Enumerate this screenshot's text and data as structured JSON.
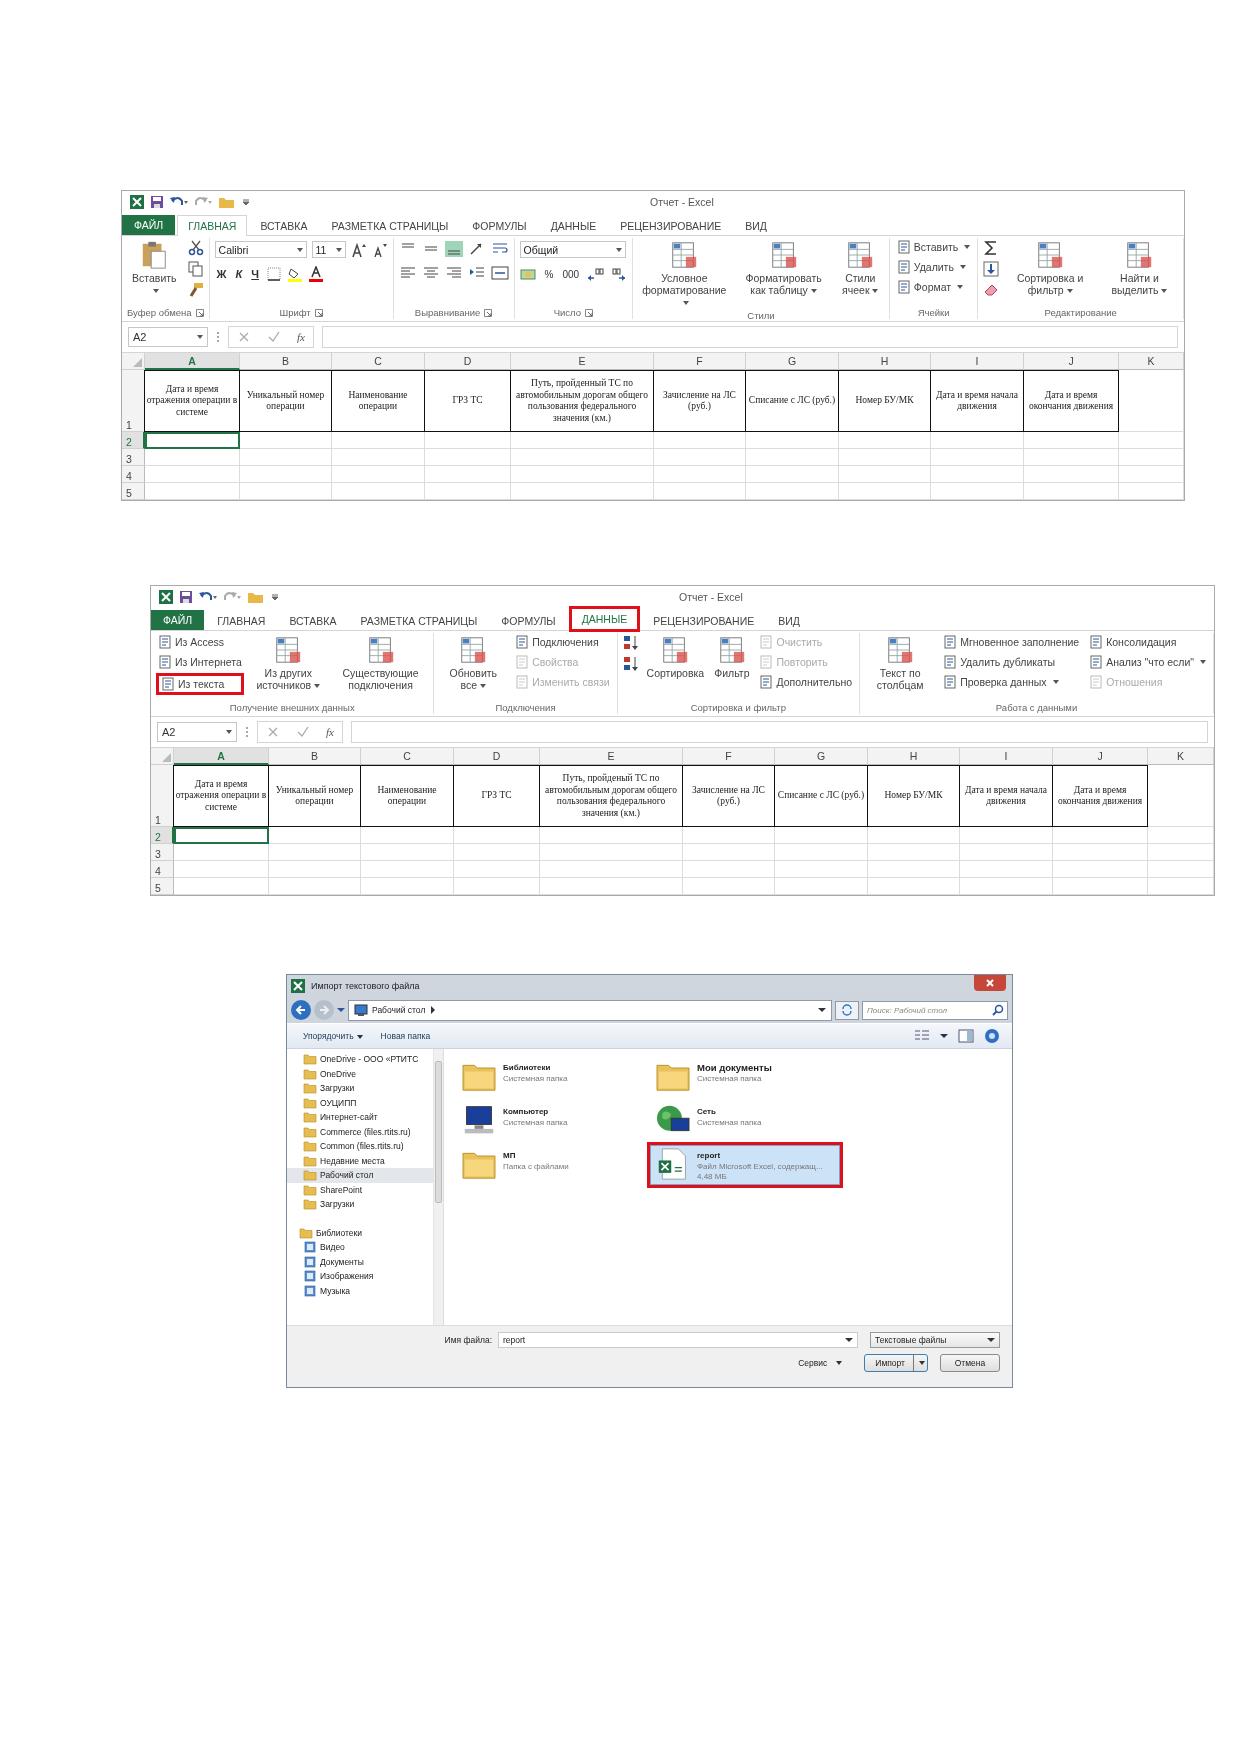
{
  "documents": [
    {
      "kind": "excel",
      "title": "Отчет - Excel",
      "file_tab": "ФАЙЛ",
      "tabs": [
        {
          "label": "ГЛАВНАЯ",
          "selected": true,
          "highlighted": false
        },
        {
          "label": "ВСТАВКА",
          "selected": false,
          "highlighted": false
        },
        {
          "label": "РАЗМЕТКА СТРАНИЦЫ",
          "selected": false,
          "highlighted": false
        },
        {
          "label": "ФОРМУЛЫ",
          "selected": false,
          "highlighted": false
        },
        {
          "label": "ДАННЫЕ",
          "selected": false,
          "highlighted": false
        },
        {
          "label": "РЕЦЕНЗИРОВАНИЕ",
          "selected": false,
          "highlighted": false
        },
        {
          "label": "ВИД",
          "selected": false,
          "highlighted": false
        }
      ],
      "ribbon": [
        {
          "kind": "clipboard",
          "label": "Буфер обмена",
          "launcher": true,
          "paste": "Вставить"
        },
        {
          "kind": "font",
          "label": "Шрифт",
          "launcher": true,
          "font": "Calibri",
          "size": "11",
          "styles": [
            "Ж",
            "К",
            "Ч"
          ]
        },
        {
          "kind": "alignment",
          "label": "Выравнивание",
          "launcher": true
        },
        {
          "kind": "number",
          "label": "Число",
          "launcher": true,
          "format": "Общий",
          "symbols": [
            "%",
            "000"
          ]
        },
        {
          "kind": "commands",
          "label": "Стили",
          "launcher": false,
          "items": [
            {
              "kind": "large",
              "label": "Условное форматирование",
              "menu": true,
              "disabled": false,
              "highlighted": false
            },
            {
              "kind": "large",
              "label": "Форматировать как таблицу",
              "menu": true,
              "disabled": false,
              "highlighted": false
            },
            {
              "kind": "large",
              "label": "Стили ячеек",
              "menu": true,
              "disabled": false,
              "highlighted": false
            }
          ]
        },
        {
          "kind": "commands",
          "label": "Ячейки",
          "launcher": false,
          "items": [
            {
              "kind": "stack",
              "items": [
                {
                  "label": "Вставить",
                  "menu": true,
                  "disabled": false,
                  "highlighted": false
                },
                {
                  "label": "Удалить",
                  "menu": true,
                  "disabled": false,
                  "highlighted": false
                },
                {
                  "label": "Формат",
                  "menu": true,
                  "disabled": false,
                  "highlighted": false
                }
              ]
            }
          ]
        },
        {
          "kind": "commands",
          "label": "Редактирование",
          "launcher": false,
          "items": [
            {
              "kind": "edit-tools"
            },
            {
              "kind": "large",
              "label": "Сортировка и фильтр",
              "menu": true,
              "disabled": false,
              "highlighted": false
            },
            {
              "kind": "large",
              "label": "Найти и выделить",
              "menu": true,
              "disabled": false,
              "highlighted": false
            }
          ]
        }
      ],
      "name_box": "A2",
      "function_label": "fx",
      "columns": [
        {
          "label": "A",
          "selected": true
        },
        {
          "label": "B",
          "selected": false
        },
        {
          "label": "C",
          "selected": false
        },
        {
          "label": "D",
          "selected": false
        },
        {
          "label": "E",
          "selected": false
        },
        {
          "label": "F",
          "selected": false
        },
        {
          "label": "G",
          "selected": false
        },
        {
          "label": "H",
          "selected": false
        },
        {
          "label": "I",
          "selected": false
        },
        {
          "label": "J",
          "selected": false
        },
        {
          "label": "K",
          "selected": false
        }
      ],
      "rows": [
        {
          "label": "1",
          "selected": false
        },
        {
          "label": "2",
          "selected": true
        },
        {
          "label": "3",
          "selected": false
        },
        {
          "label": "4",
          "selected": false
        },
        {
          "label": "5",
          "selected": false
        }
      ],
      "header_row": [
        "Дата и время отражения операции в системе",
        "Уникальный номер операции",
        "Наименование операции",
        "ГРЗ ТС",
        "Путь, пройденный ТС по автомобильным дорогам общего пользования федерального значения (км.)",
        "Зачисление на ЛС (руб.)",
        "Списание с ЛС (руб.)",
        "Номер БУ/МК",
        "Дата и время начала движения",
        "Дата и время окончания движения"
      ]
    },
    {
      "kind": "excel",
      "title": "Отчет - Excel",
      "file_tab": "ФАЙЛ",
      "tabs": [
        {
          "label": "ГЛАВНАЯ",
          "selected": false,
          "highlighted": false
        },
        {
          "label": "ВСТАВКА",
          "selected": false,
          "highlighted": false
        },
        {
          "label": "РАЗМЕТКА СТРАНИЦЫ",
          "selected": false,
          "highlighted": false
        },
        {
          "label": "ФОРМУЛЫ",
          "selected": false,
          "highlighted": false
        },
        {
          "label": "ДАННЫЕ",
          "selected": true,
          "highlighted": true
        },
        {
          "label": "РЕЦЕНЗИРОВАНИЕ",
          "selected": false,
          "highlighted": false
        },
        {
          "label": "ВИД",
          "selected": false,
          "highlighted": false
        }
      ],
      "ribbon": [
        {
          "kind": "commands",
          "label": "Получение внешних данных",
          "launcher": false,
          "items": [
            {
              "kind": "stack",
              "items": [
                {
                  "label": "Из Access",
                  "menu": false,
                  "disabled": false,
                  "highlighted": false
                },
                {
                  "label": "Из Интернета",
                  "menu": false,
                  "disabled": false,
                  "highlighted": false
                },
                {
                  "label": "Из текста",
                  "menu": false,
                  "disabled": false,
                  "highlighted": true
                }
              ]
            },
            {
              "kind": "large",
              "label": "Из других источников",
              "menu": true,
              "disabled": false,
              "highlighted": false
            },
            {
              "kind": "large",
              "label": "Существующие подключения",
              "menu": false,
              "disabled": false,
              "highlighted": false
            }
          ]
        },
        {
          "kind": "commands",
          "label": "Подключения",
          "launcher": false,
          "items": [
            {
              "kind": "large",
              "label": "Обновить все",
              "menu": true,
              "disabled": false,
              "highlighted": false
            },
            {
              "kind": "stack",
              "items": [
                {
                  "label": "Подключения",
                  "menu": false,
                  "disabled": false,
                  "highlighted": false
                },
                {
                  "label": "Свойства",
                  "menu": false,
                  "disabled": true,
                  "highlighted": false
                },
                {
                  "label": "Изменить связи",
                  "menu": false,
                  "disabled": true,
                  "highlighted": false
                }
              ]
            }
          ]
        },
        {
          "kind": "commands",
          "label": "Сортировка и фильтр",
          "launcher": false,
          "items": [
            {
              "kind": "sort-buttons"
            },
            {
              "kind": "large",
              "label": "Сортировка",
              "menu": false,
              "disabled": false,
              "highlighted": false
            },
            {
              "kind": "large",
              "label": "Фильтр",
              "menu": false,
              "disabled": false,
              "highlighted": false
            },
            {
              "kind": "stack",
              "items": [
                {
                  "label": "Очистить",
                  "menu": false,
                  "disabled": true,
                  "highlighted": false
                },
                {
                  "label": "Повторить",
                  "menu": false,
                  "disabled": true,
                  "highlighted": false
                },
                {
                  "label": "Дополнительно",
                  "menu": false,
                  "disabled": false,
                  "highlighted": false
                }
              ]
            }
          ]
        },
        {
          "kind": "commands",
          "label": "Работа с данными",
          "launcher": false,
          "items": [
            {
              "kind": "large",
              "label": "Текст по столбцам",
              "menu": false,
              "disabled": false,
              "highlighted": false
            },
            {
              "kind": "stack",
              "items": [
                {
                  "label": "Мгновенное заполнение",
                  "menu": false,
                  "disabled": false,
                  "highlighted": false
                },
                {
                  "label": "Удалить дубликаты",
                  "menu": false,
                  "disabled": false,
                  "highlighted": false
                },
                {
                  "label": "Проверка данных",
                  "menu": true,
                  "disabled": false,
                  "highlighted": false
                }
              ]
            },
            {
              "kind": "stack",
              "items": [
                {
                  "label": "Консолидация",
                  "menu": false,
                  "disabled": false,
                  "highlighted": false
                },
                {
                  "label": "Анализ \"что если\"",
                  "menu": true,
                  "disabled": false,
                  "highlighted": false
                },
                {
                  "label": "Отношения",
                  "menu": false,
                  "disabled": true,
                  "highlighted": false
                }
              ]
            }
          ]
        }
      ],
      "name_box": "A2",
      "function_label": "fx",
      "columns": [
        {
          "label": "A",
          "selected": true
        },
        {
          "label": "B",
          "selected": false
        },
        {
          "label": "C",
          "selected": false
        },
        {
          "label": "D",
          "selected": false
        },
        {
          "label": "E",
          "selected": false
        },
        {
          "label": "F",
          "selected": false
        },
        {
          "label": "G",
          "selected": false
        },
        {
          "label": "H",
          "selected": false
        },
        {
          "label": "I",
          "selected": false
        },
        {
          "label": "J",
          "selected": false
        },
        {
          "label": "K",
          "selected": false
        }
      ],
      "rows": [
        {
          "label": "1",
          "selected": false
        },
        {
          "label": "2",
          "selected": true
        },
        {
          "label": "3",
          "selected": false
        },
        {
          "label": "4",
          "selected": false
        },
        {
          "label": "5",
          "selected": false
        }
      ],
      "header_row": [
        "Дата и время отражения операции в системе",
        "Уникальный номер операции",
        "Наименование операции",
        "ГРЗ ТС",
        "Путь, пройденый ТС по автомобильным дорогам общего пользования федерального значения (км.)",
        "Зачисление на ЛС (руб.)",
        "Списание с ЛС (руб.)",
        "Номер БУ/МК",
        "Дата и время начала движения",
        "Дата и время окончания движения"
      ]
    },
    {
      "kind": "file-dialog",
      "title": "Импорт текстового файла",
      "path": "Рабочий стол",
      "search_placeholder": "Поиск: Рабочий стол",
      "toolbar": [
        {
          "label": "Упорядочить",
          "menu": true
        },
        {
          "label": "Новая папка",
          "menu": false
        }
      ],
      "nav": [
        {
          "label": "OneDrive - ООО «РТИТС",
          "selected": false
        },
        {
          "label": "OneDrive",
          "selected": false
        },
        {
          "label": "Загрузки",
          "selected": false
        },
        {
          "label": "ОУЦИПП",
          "selected": false
        },
        {
          "label": "Интернет-сайт",
          "selected": false
        },
        {
          "label": "Commerce (files.rtits.ru)",
          "selected": false
        },
        {
          "label": "Common (files.rtits.ru)",
          "selected": false
        },
        {
          "label": "Недавние места",
          "selected": false
        },
        {
          "label": "Рабочий стол",
          "selected": true
        },
        {
          "label": "SharePoint",
          "selected": false
        },
        {
          "label": "Загрузки",
          "selected": false
        },
        {
          "label": "Библиотеки",
          "selected": false,
          "children": [
            {
              "label": "Видео",
              "selected": false
            },
            {
              "label": "Документы",
              "selected": false
            },
            {
              "label": "Изображения",
              "selected": false
            },
            {
              "label": "Музыка",
              "selected": false
            }
          ]
        }
      ],
      "files": [
        {
          "kind": "folder",
          "name": "Библиотеки",
          "info": [
            "Системная папка"
          ],
          "selected": false,
          "highlighted": false
        },
        {
          "kind": "folder",
          "name": "Мои документы",
          "info": [
            "Системная папка"
          ],
          "selected": false,
          "highlighted": false
        },
        {
          "kind": "computer",
          "name": "Компьютер",
          "info": [
            "Системная папка"
          ],
          "selected": false,
          "highlighted": false
        },
        {
          "kind": "network",
          "name": "Сеть",
          "info": [
            "Системная папка"
          ],
          "selected": false,
          "highlighted": false
        },
        {
          "kind": "folder",
          "name": "МП",
          "info": [
            "Папка с файлами"
          ],
          "selected": false,
          "highlighted": false
        },
        {
          "kind": "spreadsheet",
          "name": "report",
          "info": [
            "Файл Microsoft Excel, содержащ...",
            "4,48 МБ"
          ],
          "selected": true,
          "highlighted": true
        }
      ],
      "file_name_label": "Имя файла:",
      "file_name": "report",
      "file_type": "Текстовые файлы",
      "service": "Сервис",
      "buttons": [
        {
          "kind": "split",
          "label": "Импорт"
        },
        {
          "kind": "plain",
          "label": "Отмена"
        }
      ]
    }
  ]
}
